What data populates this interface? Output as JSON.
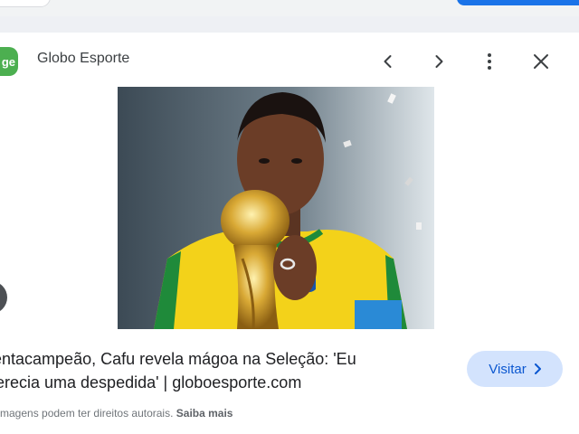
{
  "top_bar": {
    "search_icon": "search-field-edge",
    "action_button_color": "#1a73e8"
  },
  "panel": {
    "source": {
      "logo_text": "ge",
      "name": "Globo Esporte"
    },
    "header_icons": [
      "chevron-left-icon",
      "chevron-right-icon",
      "more-vert-icon",
      "close-icon"
    ],
    "image": {
      "description_icon": "photo-footballer-kissing-trophy",
      "lens_icon": "lens-icon"
    },
    "title": "Pentacampeão, Cafu revela mágoa na Seleção: 'Eu\nmerecia uma despedida' | globoesporte.com",
    "visit_label": "Visitar",
    "rights_text": "As imagens podem ter direitos autorais.",
    "learn_more_label": "Saiba mais"
  },
  "colors": {
    "logo_green": "#4caf50",
    "visit_bg": "#d3e3fd",
    "visit_text": "#0b57d0",
    "shirt_yellow": "#f3d21a"
  }
}
